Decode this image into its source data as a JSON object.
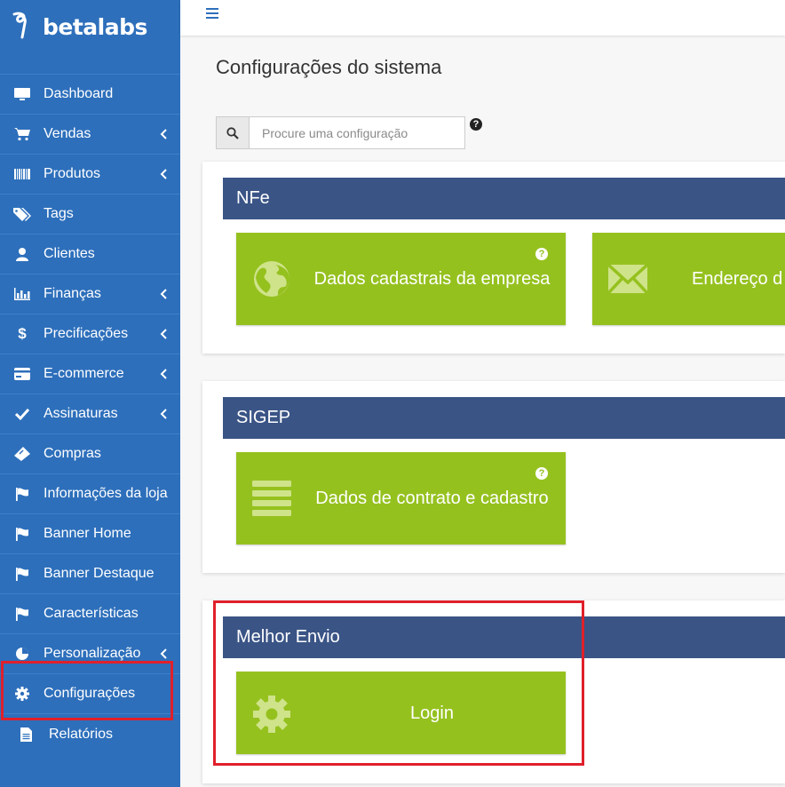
{
  "brand": {
    "name": "betalabs"
  },
  "sidebar": {
    "items": [
      {
        "label": "Dashboard",
        "icon": "monitor-icon",
        "chevron": false
      },
      {
        "label": "Vendas",
        "icon": "cart-icon",
        "chevron": true
      },
      {
        "label": "Produtos",
        "icon": "barcode-icon",
        "chevron": true
      },
      {
        "label": "Tags",
        "icon": "tags-icon",
        "chevron": false
      },
      {
        "label": "Clientes",
        "icon": "user-icon",
        "chevron": false
      },
      {
        "label": "Finanças",
        "icon": "bar-chart-icon",
        "chevron": true
      },
      {
        "label": "Precificações",
        "icon": "dollar-icon",
        "chevron": true
      },
      {
        "label": "E-commerce",
        "icon": "credit-card-icon",
        "chevron": true
      },
      {
        "label": "Assinaturas",
        "icon": "check-icon",
        "chevron": true
      },
      {
        "label": "Compras",
        "icon": "ticket-icon",
        "chevron": false
      },
      {
        "label": "Informações da loja",
        "icon": "flag-icon",
        "chevron": false
      },
      {
        "label": "Banner Home",
        "icon": "flag-icon",
        "chevron": false
      },
      {
        "label": "Banner Destaque",
        "icon": "flag-icon",
        "chevron": false
      },
      {
        "label": "Características",
        "icon": "flag-icon",
        "chevron": false
      },
      {
        "label": "Personalização",
        "icon": "pie-icon",
        "chevron": true
      },
      {
        "label": "Configurações",
        "icon": "gear-icon",
        "chevron": false
      },
      {
        "label": "Relatórios",
        "icon": "document-icon",
        "chevron": false
      }
    ]
  },
  "page": {
    "title": "Configurações do sistema"
  },
  "search": {
    "placeholder": "Procure uma configuração",
    "help": "?"
  },
  "sections": [
    {
      "title": "NFe",
      "tiles": [
        {
          "label": "Dados cadastrais da empresa",
          "icon": "globe-icon",
          "help": "?"
        },
        {
          "label": "Endereço d",
          "icon": "envelope-icon"
        }
      ]
    },
    {
      "title": "SIGEP",
      "tiles": [
        {
          "label": "Dados de contrato e cadastro",
          "icon": "list-icon",
          "help": "?"
        }
      ]
    },
    {
      "title": "Melhor Envio",
      "tiles": [
        {
          "label": "Login",
          "icon": "gear-icon"
        }
      ]
    }
  ],
  "colors": {
    "sidebar": "#2d6fbb",
    "section_header": "#3a5486",
    "tile": "#95c11f",
    "highlight": "#e0202b"
  }
}
